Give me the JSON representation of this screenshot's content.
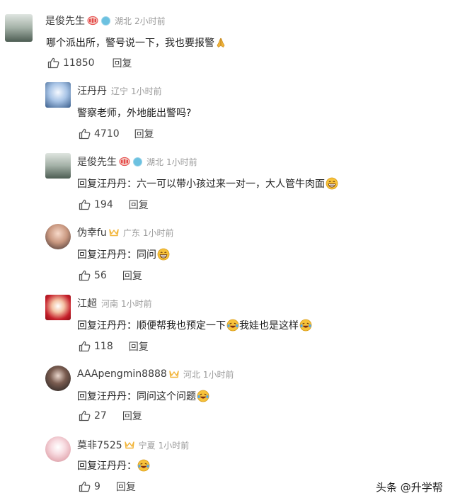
{
  "comments": [
    {
      "username": "是俊先生",
      "location": "湖北",
      "time": "2小时前",
      "text": "哪个派出所，警号说一下，我也要报警",
      "emoji": "pray",
      "likes": "11850",
      "reply_label": "回复"
    },
    {
      "username": "汪丹丹",
      "location": "辽宁",
      "time": "1小时前",
      "text": "警察老师，外地能出警吗?",
      "likes": "4710",
      "reply_label": "回复"
    },
    {
      "username": "是俊先生",
      "location": "湖北",
      "time": "1小时前",
      "text": "回复汪丹丹：六一可以带小孩过来一对一，大人管牛肉面",
      "emoji": "grin",
      "likes": "194",
      "reply_label": "回复"
    },
    {
      "username": "伪幸fu",
      "location": "广东",
      "time": "1小时前",
      "text": "回复汪丹丹：同问",
      "emoji": "grin",
      "likes": "56",
      "reply_label": "回复"
    },
    {
      "username": "江超",
      "location": "河南",
      "time": "1小时前",
      "text_parts": [
        "回复汪丹丹：顺便帮我也预定一下",
        "我娃也是这样"
      ],
      "emoji": "laugh-cry",
      "likes": "118",
      "reply_label": "回复"
    },
    {
      "username": "AAApengmin8888",
      "location": "河北",
      "time": "1小时前",
      "text": "回复汪丹丹：同问这个问题",
      "emoji": "laugh-cry",
      "likes": "27",
      "reply_label": "回复"
    },
    {
      "username": "莫非7525",
      "location": "宁夏",
      "time": "1小时前",
      "text": "回复汪丹丹：",
      "emoji": "laugh-cry",
      "likes": "9",
      "reply_label": "回复"
    }
  ],
  "watermark": "头条 @升学帮",
  "colors": {
    "text": "#1f1f1f",
    "meta": "#9a9a9a",
    "action": "#444444",
    "badge_red": "#e64a4a",
    "verify_blue": "#6cc1e0",
    "crown_gold": "#f2b53a",
    "emoji_yellow": "#f7c23a"
  }
}
